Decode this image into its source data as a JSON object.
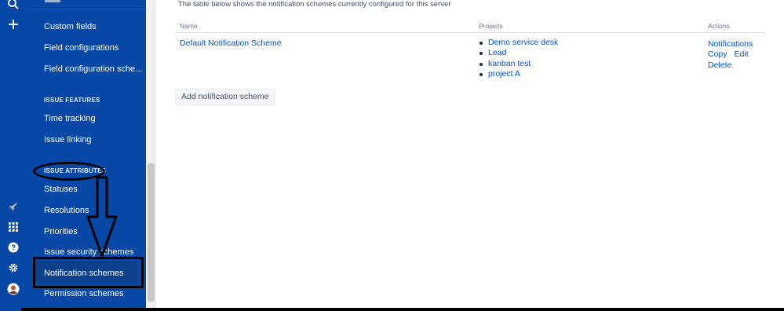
{
  "rail": {
    "icons": [
      "search-icon",
      "plus-icon",
      "rocket-icon",
      "app-switcher-icon",
      "help-icon",
      "settings-icon",
      "avatar"
    ]
  },
  "sidebar": {
    "items_top": [
      {
        "label": "Custom fields"
      },
      {
        "label": "Field configurations"
      },
      {
        "label": "Field configuration sche..."
      }
    ],
    "section_features": "ISSUE FEATURES",
    "items_features": [
      {
        "label": "Time tracking"
      },
      {
        "label": "Issue linking"
      }
    ],
    "section_attributes": "ISSUE ATTRIBUTES",
    "items_attributes": [
      {
        "label": "Statuses"
      },
      {
        "label": "Resolutions"
      },
      {
        "label": "Priorities"
      },
      {
        "label": "Issue security schemes"
      },
      {
        "label": "Notification schemes"
      },
      {
        "label": "Permission schemes"
      }
    ],
    "active_item": "Notification schemes"
  },
  "main": {
    "intro": "The table below shows the notification schemes currently configured for this server",
    "table": {
      "headers": {
        "name": "Name",
        "projects": "Projects",
        "actions": "Actions"
      },
      "rows": [
        {
          "name": "Default Notification Scheme",
          "projects": [
            "Demo service desk",
            "Lead",
            "kanban test",
            "project A"
          ],
          "actions": {
            "notifications": "Notifications",
            "copy": "Copy",
            "edit": "Edit",
            "delete": "Delete"
          }
        }
      ]
    },
    "add_button": "Add notification scheme"
  },
  "colors": {
    "sidebar_bg": "#0747a6",
    "link": "#0052cc",
    "annotation": "#000000"
  }
}
